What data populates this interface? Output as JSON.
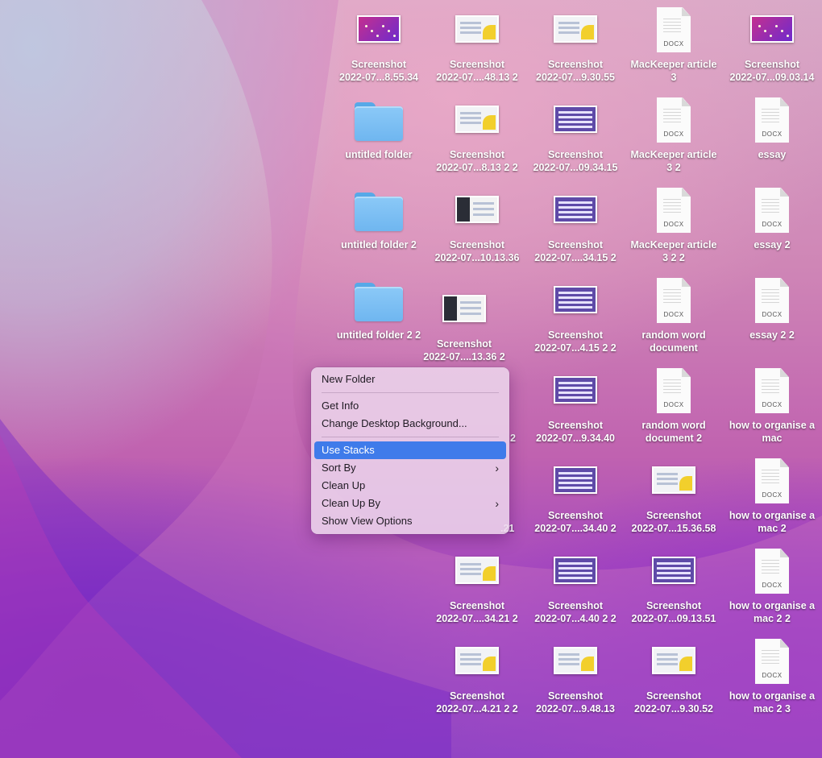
{
  "desktop": {
    "icons": [
      {
        "kind": "thumb",
        "style": "wall",
        "line1": "Screenshot",
        "line2": "2022-07...8.55.34"
      },
      {
        "kind": "thumb",
        "style": "light",
        "line1": "Screenshot",
        "line2": "2022-07....48.13 2"
      },
      {
        "kind": "thumb",
        "style": "light",
        "line1": "Screenshot",
        "line2": "2022-07...9.30.55"
      },
      {
        "kind": "doc",
        "ext": "DOCX",
        "line1": "MacKeeper article",
        "line2": "3"
      },
      {
        "kind": "thumb",
        "style": "wall",
        "line1": "Screenshot",
        "line2": "2022-07...09.03.14"
      },
      {
        "kind": "folder",
        "line1": "untitled folder",
        "line2": ""
      },
      {
        "kind": "thumb",
        "style": "light",
        "line1": "Screenshot",
        "line2": "2022-07...8.13 2 2"
      },
      {
        "kind": "thumb",
        "style": "purple",
        "line1": "Screenshot",
        "line2": "2022-07...09.34.15"
      },
      {
        "kind": "doc",
        "ext": "DOCX",
        "line1": "MacKeeper article",
        "line2": "3 2"
      },
      {
        "kind": "doc",
        "ext": "DOCX",
        "line1": "essay",
        "line2": ""
      },
      {
        "kind": "folder",
        "line1": "untitled folder 2",
        "line2": ""
      },
      {
        "kind": "thumb",
        "style": "dark",
        "line1": "Screenshot",
        "line2": "2022-07...10.13.36"
      },
      {
        "kind": "thumb",
        "style": "purple",
        "line1": "Screenshot",
        "line2": "2022-07....34.15 2"
      },
      {
        "kind": "doc",
        "ext": "DOCX",
        "line1": "MacKeeper article",
        "line2": "3 2 2"
      },
      {
        "kind": "doc",
        "ext": "DOCX",
        "line1": "essay 2",
        "line2": ""
      },
      {
        "kind": "folder",
        "line1": "untitled folder 2 2",
        "line2": ""
      },
      {
        "kind": "thumb",
        "style": "dark",
        "line1": "Screenshot",
        "line2": "2022-07....13.36 2"
      },
      {
        "kind": "thumb",
        "style": "purple",
        "line1": "Screenshot",
        "line2": "2022-07...4.15 2 2"
      },
      {
        "kind": "doc",
        "ext": "DOCX",
        "line1": "random word",
        "line2": "document"
      },
      {
        "kind": "doc",
        "ext": "DOCX",
        "line1": "essay 2 2",
        "line2": ""
      },
      {
        "kind": "thumb",
        "style": "purple",
        "line1": "Screenshot",
        "line2": "2022-07...9.34.40"
      },
      {
        "kind": "doc",
        "ext": "DOCX",
        "line1": "random word",
        "line2": "document 2"
      },
      {
        "kind": "doc",
        "ext": "DOCX",
        "line1": "how to organise a",
        "line2": "mac"
      },
      {
        "kind": "thumb",
        "style": "purple",
        "line1": "Screenshot",
        "line2": "2022-07....34.40 2"
      },
      {
        "kind": "thumb",
        "style": "light",
        "line1": "Screenshot",
        "line2": "2022-07...15.36.58"
      },
      {
        "kind": "doc",
        "ext": "DOCX",
        "line1": "how to organise a",
        "line2": "mac 2"
      },
      {
        "kind": "thumb",
        "style": "light",
        "line1": "Screenshot",
        "line2": "2022-07....34.21 2"
      },
      {
        "kind": "thumb",
        "style": "purple",
        "line1": "Screenshot",
        "line2": "2022-07...4.40 2 2"
      },
      {
        "kind": "thumb",
        "style": "purple",
        "line1": "Screenshot",
        "line2": "2022-07...09.13.51"
      },
      {
        "kind": "doc",
        "ext": "DOCX",
        "line1": "how to organise a",
        "line2": "mac 2 2"
      },
      {
        "kind": "thumb",
        "style": "light",
        "line1": "Screenshot",
        "line2": "2022-07...4.21 2 2"
      },
      {
        "kind": "thumb",
        "style": "light",
        "line1": "Screenshot",
        "line2": "2022-07...9.48.13"
      },
      {
        "kind": "thumb",
        "style": "light",
        "line1": "Screenshot",
        "line2": "2022-07...9.30.52"
      },
      {
        "kind": "doc",
        "ext": "DOCX",
        "line1": "how to organise a",
        "line2": "mac 2 3"
      }
    ],
    "hidden_fragments": [
      "2",
      ".21"
    ]
  },
  "context_menu": {
    "new_folder": "New Folder",
    "get_info": "Get Info",
    "change_background": "Change Desktop Background...",
    "use_stacks": "Use Stacks",
    "sort_by": "Sort By",
    "clean_up": "Clean Up",
    "clean_up_by": "Clean Up By",
    "show_view_options": "Show View Options",
    "submenu_icon": "chevron-right-icon",
    "highlight_color": "#3F7BEA"
  }
}
